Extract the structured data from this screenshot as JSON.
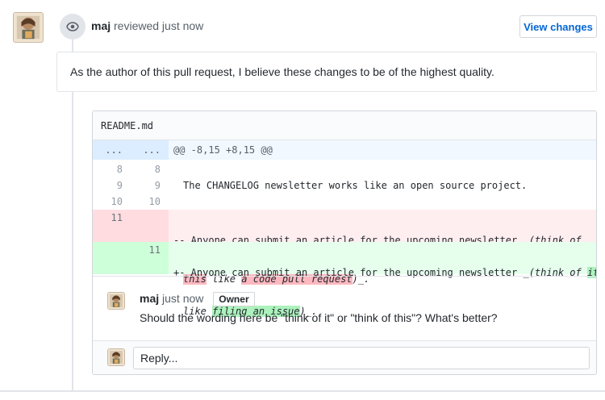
{
  "review": {
    "author": "maj",
    "action": "reviewed just now",
    "view_changes_label": "View changes",
    "body": "As the author of this pull request, I believe these changes to be of the highest quality."
  },
  "file": {
    "name": "README.md",
    "hunk": {
      "old_ln": "...",
      "new_ln": "...",
      "header": "@@ -8,15 +8,15 @@"
    },
    "lines": [
      {
        "old": "8",
        "new": "8",
        "text": ""
      },
      {
        "old": "9",
        "new": "9",
        "text": "The CHANGELOG newsletter works like an open source project."
      },
      {
        "old": "10",
        "new": "10",
        "text": ""
      }
    ],
    "deleted": {
      "old": "11",
      "prefix": "-- Anyone can submit an article for the upcoming newsletter ",
      "italic_open": "_(think of",
      "hl1": "this",
      "mid1": " like ",
      "hl2": "a code pull request",
      "tail": ")_."
    },
    "added": {
      "new": "11",
      "prefix": "+- Anyone can submit an article for the upcoming newsletter ",
      "italic_open": "_(think of ",
      "hl1": "it",
      "mid1": "like ",
      "hl2": "filing an issue",
      "tail": ")_."
    }
  },
  "comment": {
    "author": "maj",
    "time": "just now",
    "badge": "Owner",
    "text": "Should the wording here be \"think of it\" or \"think of this\"? What's better?"
  },
  "reply": {
    "placeholder": "Reply..."
  }
}
